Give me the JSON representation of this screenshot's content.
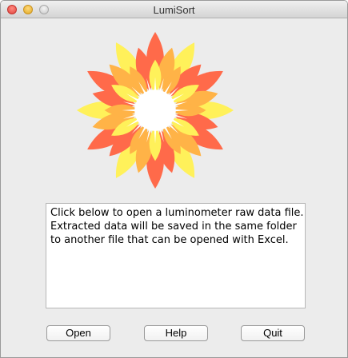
{
  "window": {
    "title": "LumiSort"
  },
  "logo": {
    "icon": "sunflower-logo-icon",
    "colors": {
      "outer": "#ff6a4a",
      "middle": "#ffb347",
      "inner": "#fff15a",
      "center": "#ffffff"
    }
  },
  "message": {
    "lines": [
      "Click below to open a luminometer raw data file.",
      "Extracted data will be saved in the same folder",
      "to another file that can be opened with Excel."
    ]
  },
  "buttons": {
    "open_label": "Open",
    "help_label": "Help",
    "quit_label": "Quit"
  }
}
